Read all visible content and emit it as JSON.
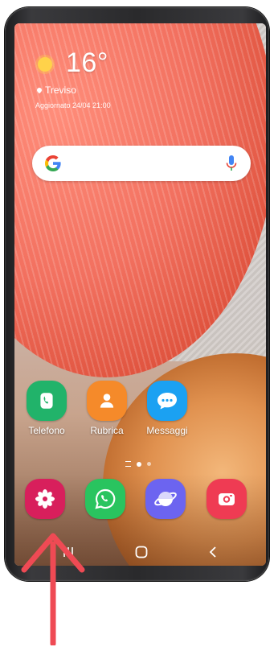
{
  "weather": {
    "temperature": "16°",
    "city": "Treviso",
    "updated": "Aggiornato 24/04 21:00"
  },
  "search": {
    "google_icon": "google-g-icon",
    "mic_icon": "microphone-icon"
  },
  "apps": [
    {
      "label": "Telefono",
      "icon": "phone-icon",
      "color": "#21b36a"
    },
    {
      "label": "Rubrica",
      "icon": "contact-icon",
      "color": "#f58a2a"
    },
    {
      "label": "Messaggi",
      "icon": "message-icon",
      "color": "#1ba1f2"
    }
  ],
  "dock": [
    {
      "name": "gallery",
      "icon": "flower-icon",
      "color": "#d81f5c"
    },
    {
      "name": "whatsapp",
      "icon": "whatsapp-icon",
      "color": "#29c45f"
    },
    {
      "name": "internet",
      "icon": "planet-icon",
      "color": "#6c64f0"
    },
    {
      "name": "camera",
      "icon": "camera-icon",
      "color": "#ef3b53"
    }
  ],
  "pages": {
    "current": 2,
    "total": 3
  },
  "nav": {
    "recents_icon": "recents-icon",
    "home_icon": "home-icon",
    "back_icon": "back-icon"
  },
  "annotation": {
    "arrow_color": "#ef4a54"
  }
}
